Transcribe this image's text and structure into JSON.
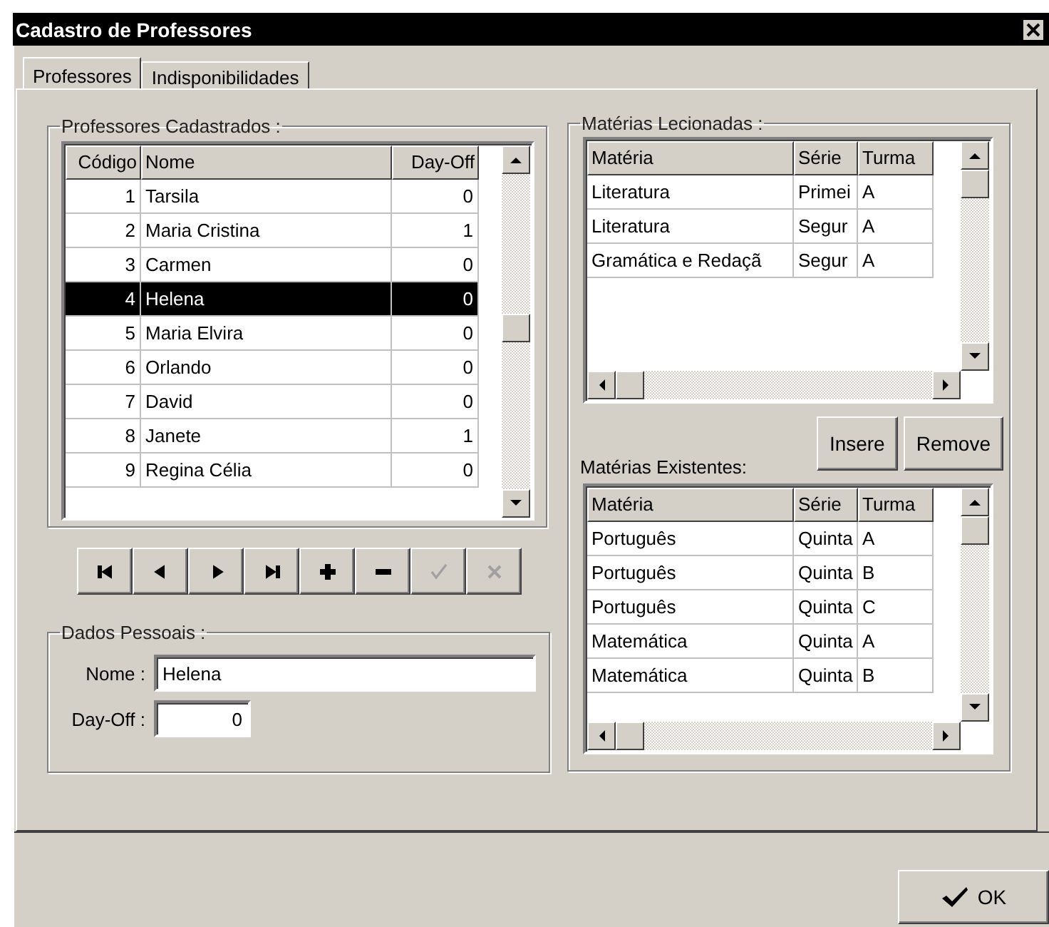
{
  "window": {
    "title": "Cadastro de Professores"
  },
  "tabs": [
    {
      "label": "Professores",
      "selected": true
    },
    {
      "label": "Indisponibilidades",
      "selected": false
    }
  ],
  "professores": {
    "title": "Professores Cadastrados :",
    "columns": [
      "Código",
      "Nome",
      "Day-Off"
    ],
    "rows": [
      {
        "cells": [
          "1",
          "Tarsila",
          "0"
        ],
        "selected": false
      },
      {
        "cells": [
          "2",
          "Maria Cristina",
          "1"
        ],
        "selected": false
      },
      {
        "cells": [
          "3",
          "Carmen",
          "0"
        ],
        "selected": false
      },
      {
        "cells": [
          "4",
          "Helena",
          "0"
        ],
        "selected": true
      },
      {
        "cells": [
          "5",
          "Maria Elvira",
          "0"
        ],
        "selected": false
      },
      {
        "cells": [
          "6",
          "Orlando",
          "0"
        ],
        "selected": false
      },
      {
        "cells": [
          "7",
          "David",
          "0"
        ],
        "selected": false
      },
      {
        "cells": [
          "8",
          "Janete",
          "1"
        ],
        "selected": false
      },
      {
        "cells": [
          "9",
          "Regina Célia",
          "0"
        ],
        "selected": false
      }
    ]
  },
  "navigator": [
    {
      "kind": "first",
      "disabled": false
    },
    {
      "kind": "prior",
      "disabled": false
    },
    {
      "kind": "next",
      "disabled": false
    },
    {
      "kind": "last",
      "disabled": false
    },
    {
      "kind": "insert",
      "disabled": false
    },
    {
      "kind": "delete",
      "disabled": false
    },
    {
      "kind": "post",
      "disabled": true
    },
    {
      "kind": "cancel",
      "disabled": true
    }
  ],
  "dados_pessoais": {
    "title": "Dados Pessoais :",
    "fields": [
      {
        "label": "Nome :",
        "value": "Helena",
        "kind": "text"
      },
      {
        "label": "Day-Off :",
        "value": "0",
        "kind": "number"
      }
    ]
  },
  "materias_lecionadas": {
    "title": "Matérias Lecionadas :",
    "columns": [
      "Matéria",
      "Série",
      "Turma"
    ],
    "rows": [
      [
        "Literatura",
        "Primei",
        "A"
      ],
      [
        "Literatura",
        "Segur",
        "A"
      ],
      [
        "Gramática e Redaçã",
        "Segur",
        "A"
      ]
    ]
  },
  "buttons": [
    "Insere",
    "Remove"
  ],
  "materias_existentes": {
    "title": "Matérias Existentes:",
    "columns": [
      "Matéria",
      "Série",
      "Turma"
    ],
    "rows": [
      [
        "Português",
        "Quinta",
        "A"
      ],
      [
        "Português",
        "Quinta",
        "B"
      ],
      [
        "Português",
        "Quinta",
        "C"
      ],
      [
        "Matemática",
        "Quinta",
        "A"
      ],
      [
        "Matemática",
        "Quinta",
        "B"
      ]
    ]
  },
  "ok_button": "OK"
}
